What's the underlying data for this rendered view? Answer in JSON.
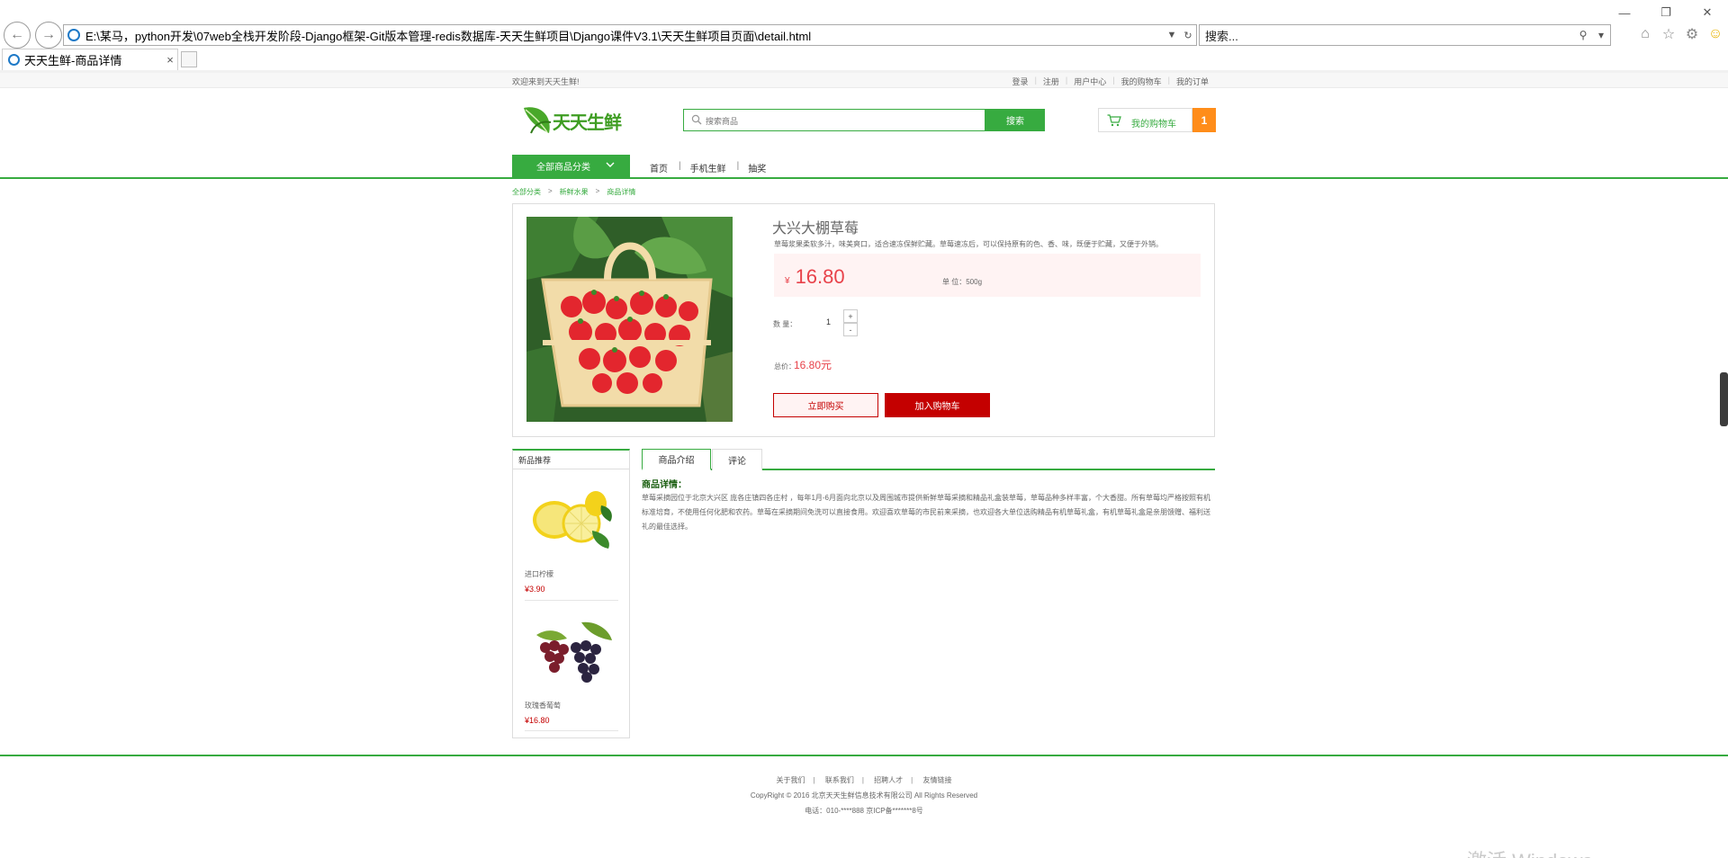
{
  "browser": {
    "address": "E:\\某马，python开发\\07web全栈开发阶段-Django框架-Git版本管理-redis数据库-天天生鲜项目\\Django课件V3.1\\天天生鲜项目页面\\detail.html",
    "search_placeholder": "搜索...",
    "tab_title": "天天生鲜-商品详情",
    "tab_close": "×",
    "window_controls": [
      "—",
      "❐",
      "✕"
    ],
    "icons": [
      "back-icon",
      "forward-icon",
      "ie-icon",
      "home-icon",
      "star-icon",
      "gear-icon",
      "smiley-icon"
    ]
  },
  "topbar": {
    "welcome": "欢迎来到天天生鲜!",
    "links": [
      "登录",
      "注册",
      "用户中心",
      "我的购物车",
      "我的订单"
    ]
  },
  "header": {
    "logo_text": "天天生鲜",
    "search_placeholder": "搜索商品",
    "search_button": "搜索",
    "cart_label": "我的购物车",
    "cart_count": "1"
  },
  "nav": {
    "all_categories": "全部商品分类",
    "items": [
      "首页",
      "手机生鲜",
      "抽奖"
    ]
  },
  "breadcrumb": [
    "全部分类",
    "新鲜水果",
    "商品详情"
  ],
  "product": {
    "name": "大兴大棚草莓",
    "description": "草莓浆果柔软多汁，味美爽口，适合速冻保鲜贮藏。草莓速冻后，可以保持原有的色、香、味，既便于贮藏，又便于外销。",
    "currency": "¥",
    "price": "16.80",
    "unit_label": "单 位：",
    "unit": "500g",
    "qty_label": "数 量：",
    "qty": "1",
    "plus": "+",
    "minus": "-",
    "total_label": "总价：",
    "total": "16.80元",
    "buy_now": "立即购买",
    "add_to_cart": "加入购物车"
  },
  "recommend": {
    "title": "新品推荐",
    "items": [
      {
        "name": "进口柠檬",
        "price": "¥3.90"
      },
      {
        "name": "玫瑰香葡萄",
        "price": "¥16.80"
      }
    ]
  },
  "detail_tabs": [
    "商品介绍",
    "评论"
  ],
  "detail": {
    "title": "商品详情：",
    "text": "草莓采摘园位于北京大兴区 庞各庄镇四各庄村 ，每年1月-6月面向北京以及周围城市提供新鲜草莓采摘和精品礼盒装草莓，草莓品种多样丰富，个大香甜。所有草莓均严格按照有机标准培育，不使用任何化肥和农药。草莓在采摘期间免洗可以直接食用。欢迎喜欢草莓的市民前来采摘，也欢迎各大单位选购精品有机草莓礼盒，有机草莓礼盒是亲朋馈赠、福利送礼的最佳选择。"
  },
  "footer": {
    "links": [
      "关于我们",
      "联系我们",
      "招聘人才",
      "友情链接"
    ],
    "copyright": "CopyRight © 2016 北京天天生鲜信息技术有限公司 All Rights Reserved",
    "tel": "电话：010-****888    京ICP备*******8号"
  },
  "watermark": "激活 Windows",
  "colors": {
    "brand_green": "#37ab40",
    "price_red": "#e8424a",
    "button_red": "#c40000",
    "cart_orange": "#ff8d1a"
  }
}
